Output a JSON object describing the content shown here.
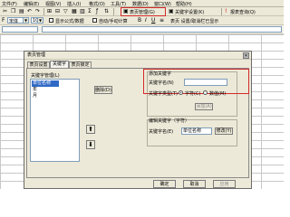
{
  "menubar": {
    "items": [
      "文件(F)",
      "编辑(E)",
      "视图(V)",
      "插入(I)",
      "格式(O)",
      "工具(T)",
      "数据(D)",
      "窗口(W)",
      "帮助(H)"
    ]
  },
  "toolbar1": {
    "page_mgmt_button": "表页管理(G)",
    "keyword_set_button": "关键字设置(K)",
    "report_query_button": "报表查询(Q)",
    "checkbox_label": "打开后台运行"
  },
  "toolbar2": {
    "font_select": "宋体",
    "size_select": "10",
    "show_formula_label": "显示公式/数据",
    "auto_calc_label": "自动/手动计算",
    "page_set_label": "表页 设置/取消栏已显示"
  },
  "dialog": {
    "title": "表页管理",
    "close": "✕",
    "tabs": [
      "表页设置",
      "关键字",
      "表页锁定"
    ],
    "list_title": "关键字管理(L)",
    "list_items": [
      "单位名称",
      "年",
      "月"
    ],
    "delete_button": "删除(D)",
    "add_group": {
      "title": "添加关键字",
      "name_label": "关键字名(N)",
      "name_value": "",
      "type_label": "关键字类型(T)",
      "type_char": "字符(C)",
      "type_num": "数值(M)",
      "add_button": "添加(A)"
    },
    "edit_group": {
      "title": "编辑关键字（字符）",
      "name_label": "关键字名(E)",
      "name_value": "单位名称",
      "modify_button": "修改(Y)"
    },
    "ok_button": "确定",
    "cancel_button": "取消",
    "apply_button": "应用"
  },
  "colors": {
    "highlight": "#d42a2a",
    "selection": "#316ac5"
  }
}
